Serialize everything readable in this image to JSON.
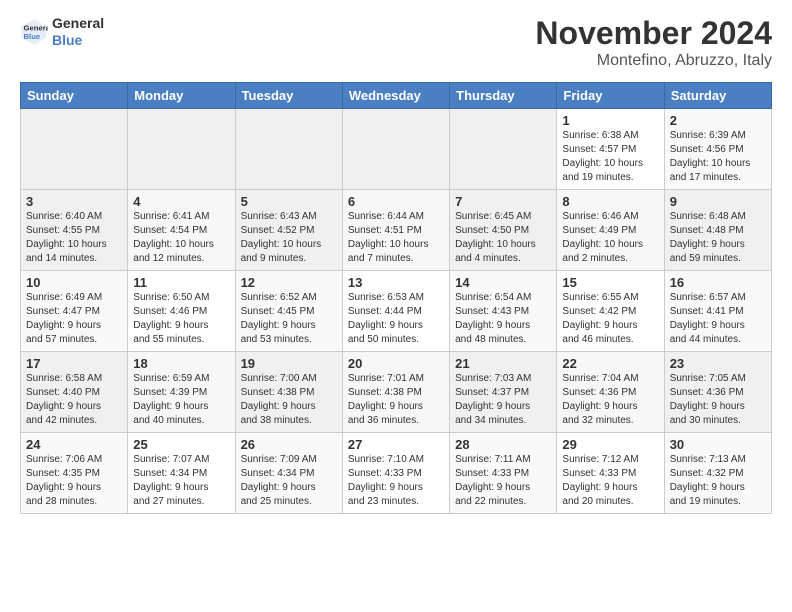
{
  "header": {
    "logo_line1": "General",
    "logo_line2": "Blue",
    "month_title": "November 2024",
    "location": "Montefino, Abruzzo, Italy"
  },
  "weekdays": [
    "Sunday",
    "Monday",
    "Tuesday",
    "Wednesday",
    "Thursday",
    "Friday",
    "Saturday"
  ],
  "weeks": [
    [
      {
        "day": "",
        "info": ""
      },
      {
        "day": "",
        "info": ""
      },
      {
        "day": "",
        "info": ""
      },
      {
        "day": "",
        "info": ""
      },
      {
        "day": "",
        "info": ""
      },
      {
        "day": "1",
        "info": "Sunrise: 6:38 AM\nSunset: 4:57 PM\nDaylight: 10 hours\nand 19 minutes."
      },
      {
        "day": "2",
        "info": "Sunrise: 6:39 AM\nSunset: 4:56 PM\nDaylight: 10 hours\nand 17 minutes."
      }
    ],
    [
      {
        "day": "3",
        "info": "Sunrise: 6:40 AM\nSunset: 4:55 PM\nDaylight: 10 hours\nand 14 minutes."
      },
      {
        "day": "4",
        "info": "Sunrise: 6:41 AM\nSunset: 4:54 PM\nDaylight: 10 hours\nand 12 minutes."
      },
      {
        "day": "5",
        "info": "Sunrise: 6:43 AM\nSunset: 4:52 PM\nDaylight: 10 hours\nand 9 minutes."
      },
      {
        "day": "6",
        "info": "Sunrise: 6:44 AM\nSunset: 4:51 PM\nDaylight: 10 hours\nand 7 minutes."
      },
      {
        "day": "7",
        "info": "Sunrise: 6:45 AM\nSunset: 4:50 PM\nDaylight: 10 hours\nand 4 minutes."
      },
      {
        "day": "8",
        "info": "Sunrise: 6:46 AM\nSunset: 4:49 PM\nDaylight: 10 hours\nand 2 minutes."
      },
      {
        "day": "9",
        "info": "Sunrise: 6:48 AM\nSunset: 4:48 PM\nDaylight: 9 hours\nand 59 minutes."
      }
    ],
    [
      {
        "day": "10",
        "info": "Sunrise: 6:49 AM\nSunset: 4:47 PM\nDaylight: 9 hours\nand 57 minutes."
      },
      {
        "day": "11",
        "info": "Sunrise: 6:50 AM\nSunset: 4:46 PM\nDaylight: 9 hours\nand 55 minutes."
      },
      {
        "day": "12",
        "info": "Sunrise: 6:52 AM\nSunset: 4:45 PM\nDaylight: 9 hours\nand 53 minutes."
      },
      {
        "day": "13",
        "info": "Sunrise: 6:53 AM\nSunset: 4:44 PM\nDaylight: 9 hours\nand 50 minutes."
      },
      {
        "day": "14",
        "info": "Sunrise: 6:54 AM\nSunset: 4:43 PM\nDaylight: 9 hours\nand 48 minutes."
      },
      {
        "day": "15",
        "info": "Sunrise: 6:55 AM\nSunset: 4:42 PM\nDaylight: 9 hours\nand 46 minutes."
      },
      {
        "day": "16",
        "info": "Sunrise: 6:57 AM\nSunset: 4:41 PM\nDaylight: 9 hours\nand 44 minutes."
      }
    ],
    [
      {
        "day": "17",
        "info": "Sunrise: 6:58 AM\nSunset: 4:40 PM\nDaylight: 9 hours\nand 42 minutes."
      },
      {
        "day": "18",
        "info": "Sunrise: 6:59 AM\nSunset: 4:39 PM\nDaylight: 9 hours\nand 40 minutes."
      },
      {
        "day": "19",
        "info": "Sunrise: 7:00 AM\nSunset: 4:38 PM\nDaylight: 9 hours\nand 38 minutes."
      },
      {
        "day": "20",
        "info": "Sunrise: 7:01 AM\nSunset: 4:38 PM\nDaylight: 9 hours\nand 36 minutes."
      },
      {
        "day": "21",
        "info": "Sunrise: 7:03 AM\nSunset: 4:37 PM\nDaylight: 9 hours\nand 34 minutes."
      },
      {
        "day": "22",
        "info": "Sunrise: 7:04 AM\nSunset: 4:36 PM\nDaylight: 9 hours\nand 32 minutes."
      },
      {
        "day": "23",
        "info": "Sunrise: 7:05 AM\nSunset: 4:36 PM\nDaylight: 9 hours\nand 30 minutes."
      }
    ],
    [
      {
        "day": "24",
        "info": "Sunrise: 7:06 AM\nSunset: 4:35 PM\nDaylight: 9 hours\nand 28 minutes."
      },
      {
        "day": "25",
        "info": "Sunrise: 7:07 AM\nSunset: 4:34 PM\nDaylight: 9 hours\nand 27 minutes."
      },
      {
        "day": "26",
        "info": "Sunrise: 7:09 AM\nSunset: 4:34 PM\nDaylight: 9 hours\nand 25 minutes."
      },
      {
        "day": "27",
        "info": "Sunrise: 7:10 AM\nSunset: 4:33 PM\nDaylight: 9 hours\nand 23 minutes."
      },
      {
        "day": "28",
        "info": "Sunrise: 7:11 AM\nSunset: 4:33 PM\nDaylight: 9 hours\nand 22 minutes."
      },
      {
        "day": "29",
        "info": "Sunrise: 7:12 AM\nSunset: 4:33 PM\nDaylight: 9 hours\nand 20 minutes."
      },
      {
        "day": "30",
        "info": "Sunrise: 7:13 AM\nSunset: 4:32 PM\nDaylight: 9 hours\nand 19 minutes."
      }
    ]
  ]
}
